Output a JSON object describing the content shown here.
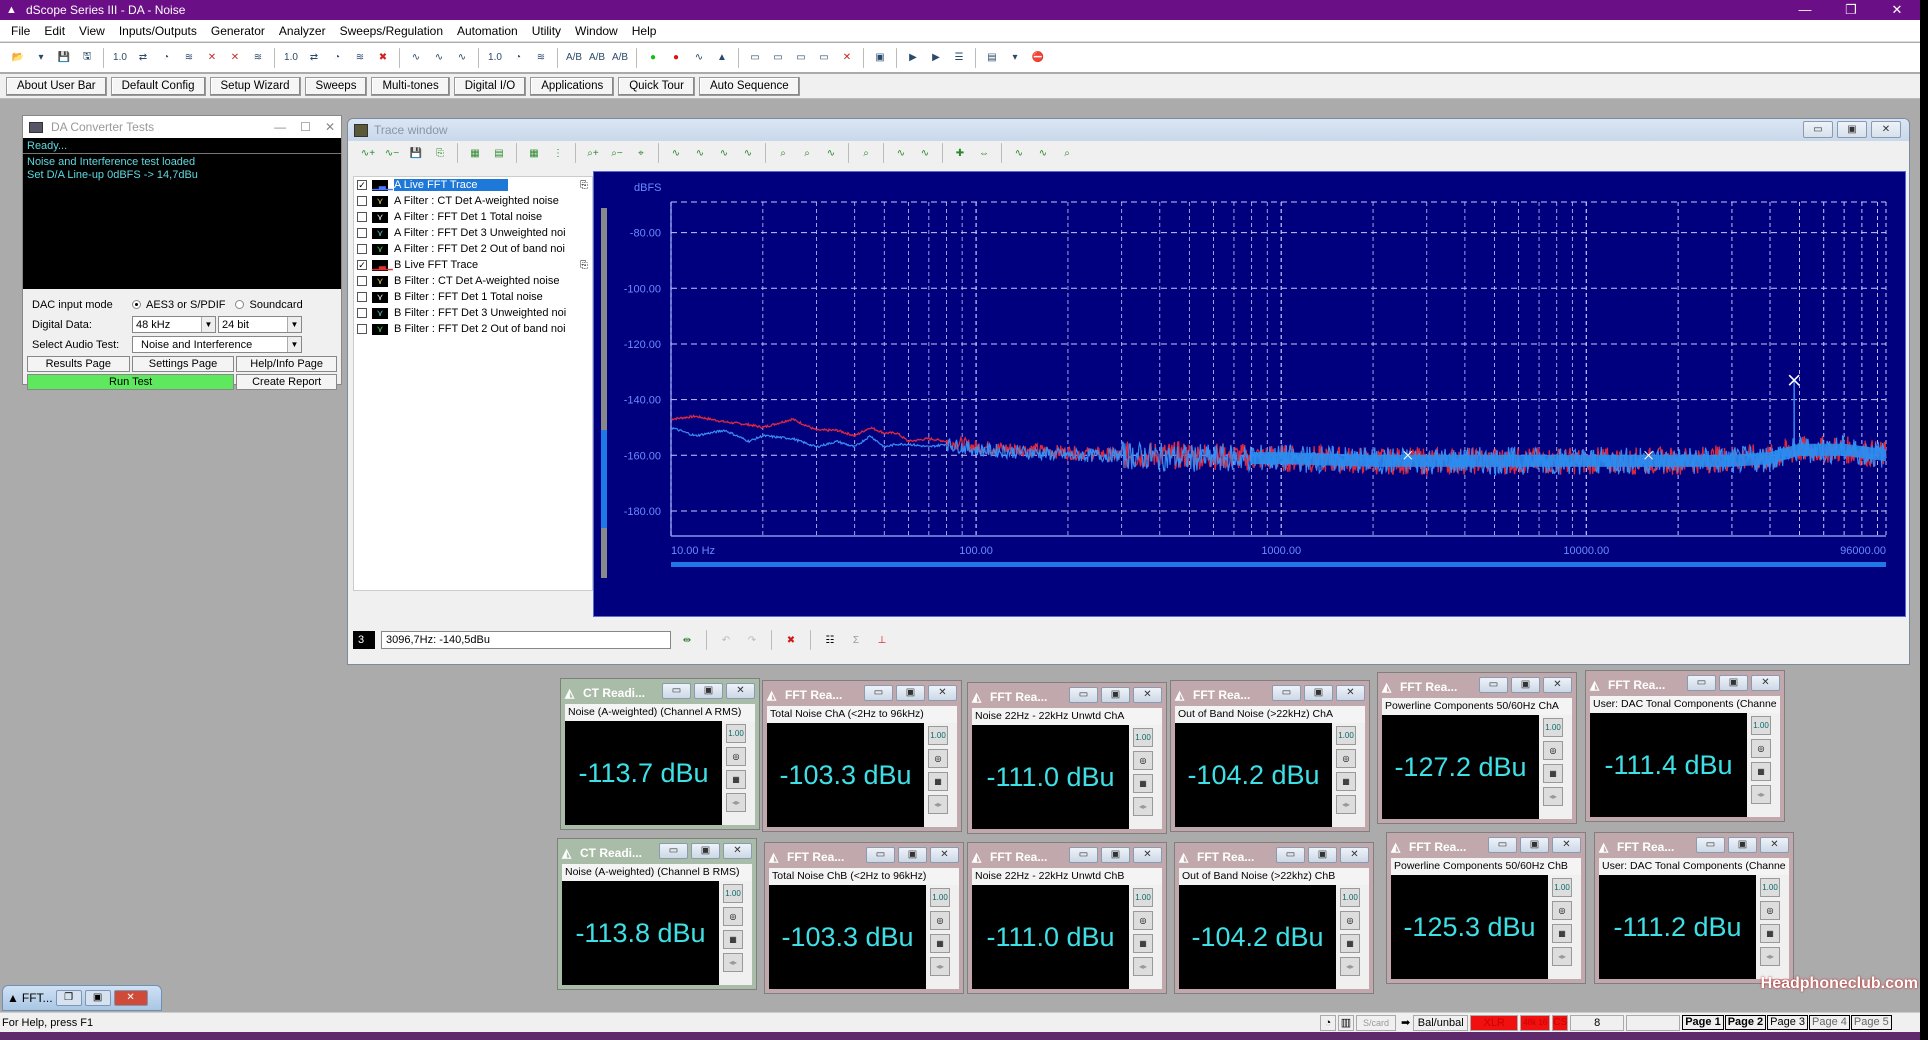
{
  "app": {
    "title": "dScope Series III - DA - Noise",
    "controls": {
      "minimize": "—",
      "restore": "❐",
      "close": "✕"
    }
  },
  "menu": [
    "File",
    "Edit",
    "View",
    "Inputs/Outputs",
    "Generator",
    "Analyzer",
    "Sweeps/Regulation",
    "Automation",
    "Utility",
    "Window",
    "Help"
  ],
  "toolbar": {
    "icons": [
      "open-folder-icon",
      "dropdown-arrow-icon",
      "save-icon",
      "save-as-icon",
      "output-level-icon",
      "output-switch-icon",
      "output-meter-icon",
      "output-filter-icon",
      "output-off-icon",
      "output-mute-icon",
      "output-noise-icon",
      "input-level-icon",
      "input-switch-icon",
      "input-meter-icon",
      "input-filter-icon",
      "clear-icon",
      "waveform-icon",
      "waveform-off-icon",
      "waveform-disabled-icon",
      "analyzer-level-icon",
      "analyzer-meter-icon",
      "analyzer-filter-icon",
      "channel-ab-icon-1",
      "channel-ab-icon-2",
      "channel-ab-icon-3",
      "go-green-icon",
      "stop-red-icon",
      "sweep-icon",
      "spectrum-icon",
      "link-icon-1",
      "link-icon-2",
      "link-icon-3",
      "link-icon-4",
      "marker-clear-icon",
      "scope-display-icon",
      "play-script-icon",
      "script-disabled-icon",
      "script-list-icon",
      "sequence-icon",
      "dropdown-arrow-icon",
      "stop-sequence-icon"
    ],
    "glyphs": [
      "📂",
      "▾",
      "💾",
      "🖫",
      "1.0",
      "⇄",
      "◔",
      "≋",
      "✕",
      "✕",
      "≋",
      "1.0",
      "⇄",
      "◔",
      "≋",
      "✖",
      "∿",
      "∿",
      "∿",
      "1.0",
      "◔",
      "≋",
      "A/B",
      "A/B",
      "A/B",
      "●",
      "●",
      "∿",
      "▲",
      "▭",
      "▭",
      "▭",
      "▭",
      "✕",
      "▣",
      "▶",
      "▶",
      "☰",
      "▤",
      "▾",
      "⛔"
    ]
  },
  "userbar": [
    "About User Bar",
    "Default Config",
    "Setup Wizard",
    "Sweeps",
    "Multi-tones",
    "Digital I/O",
    "Applications",
    "Quick Tour",
    "Auto Sequence"
  ],
  "da_window": {
    "title": "DA Converter Tests",
    "status": "Ready...",
    "log": [
      "Noise and Interference test loaded",
      "Set D/A Line-up 0dBFS -> 14,7dBu"
    ],
    "input_mode_label": "DAC input mode",
    "input_mode_options": [
      "AES3 or S/PDIF",
      "Soundcard"
    ],
    "input_mode_selected": "AES3 or S/PDIF",
    "digital_data_label": "Digital Data:",
    "sample_rate": "48 kHz",
    "bit_depth": "24 bit",
    "audio_test_label": "Select Audio Test:",
    "audio_test": "Noise and Interference",
    "buttons": {
      "results": "Results Page",
      "settings": "Settings Page",
      "help": "Help/Info Page",
      "run": "Run Test",
      "report": "Create Report"
    }
  },
  "trace_window": {
    "title": "Trace window",
    "traces": [
      {
        "label": "A Live FFT Trace",
        "checked": true,
        "selected": true,
        "icon_color": "#4a7aff",
        "type": "fft"
      },
      {
        "label": "A Filter : CT Det A-weighted noise",
        "checked": false,
        "icon_color": "#e8e050",
        "type": "filter"
      },
      {
        "label": "A Filter : FFT Det 1 Total noise",
        "checked": false,
        "icon_color": "#ffffff",
        "type": "filter"
      },
      {
        "label": "A Filter : FFT Det 3 Unweighted noi",
        "checked": false,
        "icon_color": "#60d8d0",
        "type": "filter"
      },
      {
        "label": "A Filter : FFT Det 2 Out of band noi",
        "checked": false,
        "icon_color": "#60e060",
        "type": "filter"
      },
      {
        "label": "B Live FFT Trace",
        "checked": true,
        "selected": false,
        "icon_color": "#e03030",
        "type": "fft"
      },
      {
        "label": "B Filter : CT Det A-weighted noise",
        "checked": false,
        "icon_color": "#e8e050",
        "type": "filter"
      },
      {
        "label": "B Filter : FFT Det 1 Total noise",
        "checked": false,
        "icon_color": "#ffffff",
        "type": "filter"
      },
      {
        "label": "B Filter : FFT Det 3 Unweighted noi",
        "checked": false,
        "icon_color": "#60d8d0",
        "type": "filter"
      },
      {
        "label": "B Filter : FFT Det 2 Out of band noi",
        "checked": false,
        "icon_color": "#60e060",
        "type": "filter"
      }
    ],
    "cursor_number": "3",
    "cursor_readout": "3096,7Hz: -140,5dBu"
  },
  "chart_data": {
    "type": "line",
    "title": "",
    "ylabel": "dBFS",
    "xlabel": "",
    "xscale": "log",
    "xlim": [
      10,
      96000
    ],
    "ylim": [
      -189,
      -69
    ],
    "y_ticks": [
      -80,
      -100,
      -120,
      -140,
      -160,
      -180
    ],
    "y_tick_labels": [
      "-80.00",
      "-100.00",
      "-120.00",
      "-140.00",
      "-160.00",
      "-180.00"
    ],
    "x_tick_labels": [
      {
        "value": 10,
        "label": "10.00 Hz"
      },
      {
        "value": 100,
        "label": "100.00"
      },
      {
        "value": 1000,
        "label": "1000.00"
      },
      {
        "value": 10000,
        "label": "10000.00"
      },
      {
        "value": 96000,
        "label": "96000.00"
      }
    ],
    "grid": true,
    "background": "#00007f",
    "series": [
      {
        "name": "B Live FFT Trace",
        "color": "#e0283c",
        "x": [
          10,
          12,
          15,
          18,
          20,
          25,
          30,
          35,
          40,
          45,
          50,
          55,
          60,
          70,
          80,
          90,
          100,
          150,
          200,
          300,
          500,
          1000,
          2000,
          5000,
          10000,
          20000,
          30000,
          40000,
          50000,
          70000,
          96000
        ],
        "y": [
          -147,
          -146,
          -148,
          -149,
          -150,
          -147,
          -151,
          -151,
          -153,
          -150,
          -152,
          -152,
          -155,
          -154,
          -155,
          -156,
          -157,
          -158,
          -159,
          -160,
          -160,
          -161,
          -162,
          -162,
          -162,
          -162,
          -161,
          -161,
          -158,
          -158,
          -160
        ]
      },
      {
        "name": "A Live FFT Trace",
        "color": "#3a8cf0",
        "x": [
          10,
          12,
          15,
          18,
          20,
          25,
          30,
          35,
          40,
          45,
          50,
          55,
          60,
          70,
          80,
          90,
          100,
          150,
          200,
          300,
          500,
          1000,
          2000,
          5000,
          10000,
          20000,
          30000,
          40000,
          50000,
          70000,
          96000
        ],
        "y": [
          -150,
          -153,
          -151,
          -155,
          -153,
          -154,
          -157,
          -155,
          -157,
          -153,
          -157,
          -156,
          -156,
          -157,
          -156,
          -157,
          -158,
          -159,
          -160,
          -160,
          -161,
          -161,
          -162,
          -162,
          -162,
          -162,
          -162,
          -161,
          -158,
          -158,
          -160
        ]
      }
    ],
    "markers": [
      {
        "x": 2600,
        "y": -160,
        "size": "small"
      },
      {
        "x": 16000,
        "y": -160,
        "size": "small"
      },
      {
        "x": 48000,
        "y": -133,
        "size": "large",
        "spike_from": -160
      }
    ]
  },
  "readouts": [
    {
      "kind": "CT",
      "title": "CT Readi...",
      "label": "Noise (A-weighted) (Channel A RMS)",
      "value": "-113.7 dBu"
    },
    {
      "kind": "FFT",
      "title": "FFT Rea...",
      "label": "Total Noise ChA  (<2Hz to 96kHz)",
      "value": "-103.3 dBu"
    },
    {
      "kind": "FFT",
      "title": "FFT Rea...",
      "label": "Noise 22Hz - 22kHz Unwtd ChA",
      "value": "-111.0 dBu"
    },
    {
      "kind": "FFT",
      "title": "FFT Rea...",
      "label": "Out of Band Noise (>22kHz) ChA",
      "value": "-104.2 dBu"
    },
    {
      "kind": "FFT",
      "title": "FFT Rea...",
      "label": "Powerline Components 50/60Hz ChA",
      "value": "-127.2 dBu"
    },
    {
      "kind": "FFT",
      "title": "FFT Rea...",
      "label": "User: DAC Tonal Components (Channe",
      "value": "-111.4 dBu"
    },
    {
      "kind": "CT",
      "title": "CT Readi...",
      "label": "Noise (A-weighted) (Channel B RMS)",
      "value": "-113.8 dBu"
    },
    {
      "kind": "FFT",
      "title": "FFT Rea...",
      "label": "Total Noise ChB  (<2Hz to 96kHz)",
      "value": "-103.3 dBu"
    },
    {
      "kind": "FFT",
      "title": "FFT Rea...",
      "label": "Noise 22Hz - 22kHz Unwtd ChB",
      "value": "-111.0 dBu"
    },
    {
      "kind": "FFT",
      "title": "FFT Rea...",
      "label": "Out of Band Noise (>22khz) ChB",
      "value": "-104.2 dBu"
    },
    {
      "kind": "FFT",
      "title": "FFT Rea...",
      "label": "Powerline Components 50/60Hz ChB",
      "value": "-125.3 dBu"
    },
    {
      "kind": "FFT",
      "title": "FFT Rea...",
      "label": "User: DAC Tonal Components (Channe",
      "value": "-111.2 dBu"
    }
  ],
  "minimized_window": {
    "title": "FFT..."
  },
  "statusbar": {
    "help": "For Help, press F1",
    "scard": "S/card",
    "balance": "Bal/unbal",
    "connector": "XLR",
    "rate": "48k 16",
    "cs": "CS",
    "count": "8",
    "pages": [
      "Page 1",
      "Page 2",
      "Page 3",
      "Page 4",
      "Page 5"
    ]
  },
  "watermark": "Headphoneclub.com"
}
